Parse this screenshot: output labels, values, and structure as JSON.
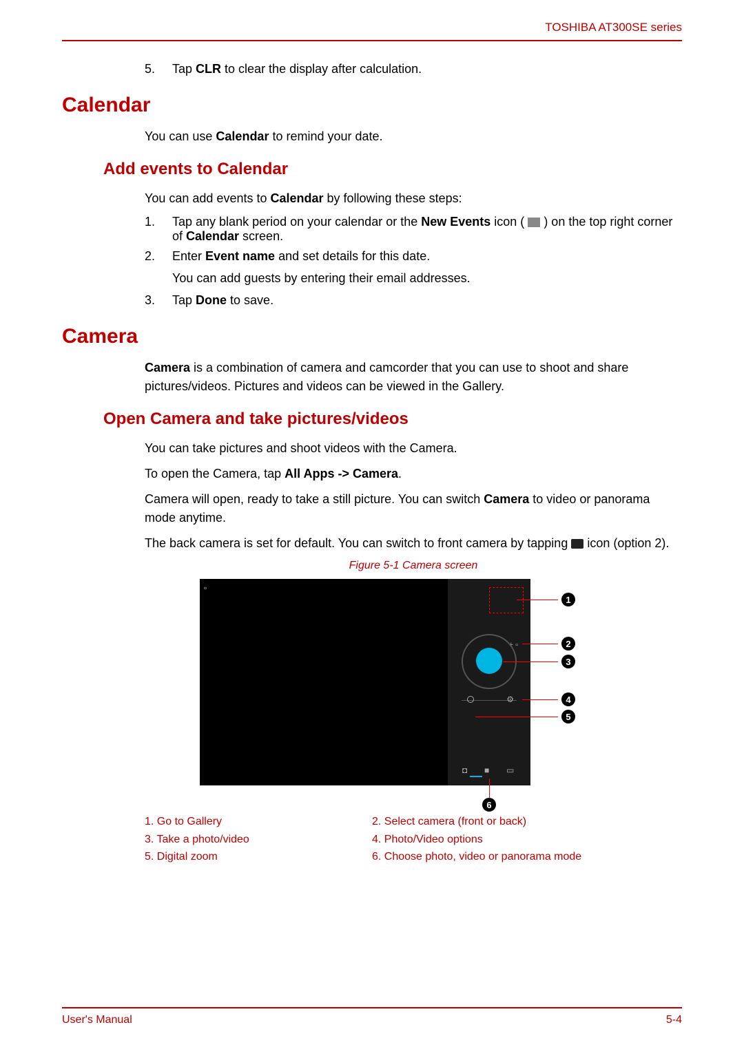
{
  "header": {
    "product": "TOSHIBA AT300SE series"
  },
  "intro_step": {
    "num": "5.",
    "text_before": "Tap ",
    "bold": "CLR",
    "text_after": " to clear the display after calculation."
  },
  "calendar": {
    "heading": "Calendar",
    "intro_before": "You can use ",
    "intro_bold": "Calendar",
    "intro_after": " to remind your date.",
    "subheading": "Add events to Calendar",
    "sub_intro_before": "You can add events to ",
    "sub_intro_bold": "Calendar",
    "sub_intro_after": " by following these steps:",
    "steps": [
      {
        "num": "1.",
        "parts": [
          {
            "t": "Tap any blank period on your calendar or the "
          },
          {
            "b": "New Events"
          },
          {
            "t": " icon ( "
          },
          {
            "icon": true
          },
          {
            "t": " ) on the top right corner of "
          },
          {
            "b": "Calendar"
          },
          {
            "t": " screen."
          }
        ]
      },
      {
        "num": "2.",
        "parts": [
          {
            "t": "Enter "
          },
          {
            "b": "Event name"
          },
          {
            "t": " and set details for this date."
          }
        ],
        "sub": "You can add guests by entering their email addresses."
      },
      {
        "num": "3.",
        "parts": [
          {
            "t": "Tap "
          },
          {
            "b": "Done"
          },
          {
            "t": " to save."
          }
        ]
      }
    ]
  },
  "camera": {
    "heading": "Camera",
    "intro_bold": "Camera",
    "intro_after": " is a combination of camera and camcorder that you can use to shoot and share pictures/videos. Pictures and videos can be viewed in the Gallery.",
    "subheading": "Open Camera and take pictures/videos",
    "p1": "You can take pictures and shoot videos with the Camera.",
    "p2_before": "To open the Camera, tap ",
    "p2_bold": "All Apps -> Camera",
    "p2_after": ".",
    "p3_before": "Camera will open, ready to take a still picture. You can switch ",
    "p3_bold": "Camera",
    "p3_after": " to video or panorama mode anytime.",
    "p4_before": "The back camera is set for default. You can switch to front camera by tapping ",
    "p4_after": " icon (option 2).",
    "figure_caption": "Figure 5-1 Camera screen",
    "legend": [
      {
        "l": "1. Go to Gallery",
        "r": "2. Select camera (front or back)"
      },
      {
        "l": "3. Take a photo/video",
        "r": "4. Photo/Video options"
      },
      {
        "l": "5. Digital zoom",
        "r": "6. Choose photo, video or panorama mode"
      }
    ]
  },
  "footer": {
    "left": "User's Manual",
    "right": "5-4"
  }
}
